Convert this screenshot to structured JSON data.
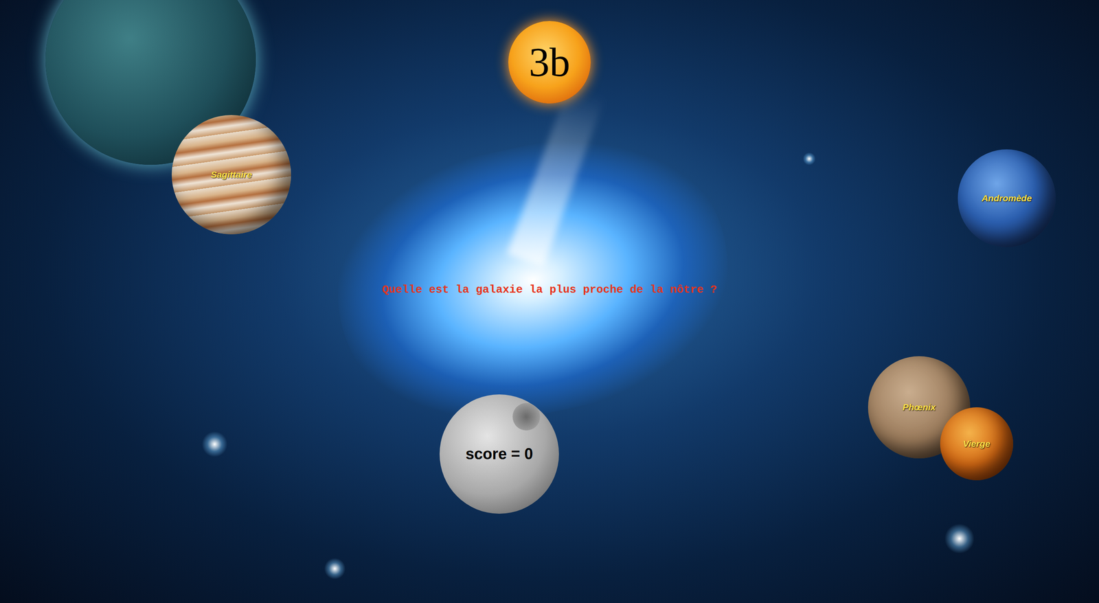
{
  "timer": "3b",
  "question": "Quelle est la galaxie la plus proche de la nôtre ?",
  "answers": [
    {
      "label": "Sagittaire"
    },
    {
      "label": "Andromède"
    },
    {
      "label": "Phœnix"
    },
    {
      "label": "Vierge"
    }
  ],
  "score": "score = 0"
}
